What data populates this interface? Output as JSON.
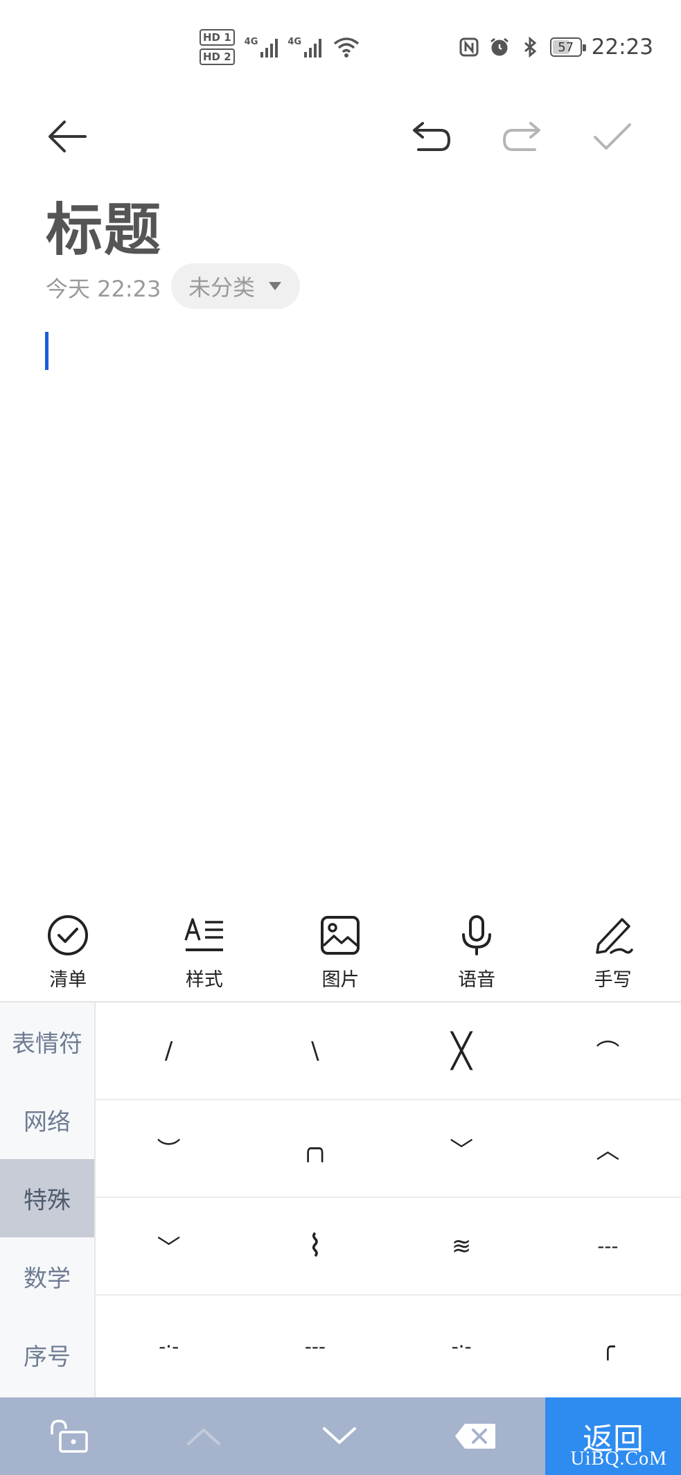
{
  "status_bar": {
    "hd1": "HD 1",
    "hd2": "HD 2",
    "sim1_network": "4G",
    "sim2_network": "4G",
    "battery_level": "57",
    "time": "22:23"
  },
  "note": {
    "title": "标题",
    "date": "今天 22:23",
    "category": "未分类"
  },
  "editor_toolbar": {
    "items": [
      {
        "label": "清单",
        "icon": "checklist-icon"
      },
      {
        "label": "样式",
        "icon": "text-style-icon"
      },
      {
        "label": "图片",
        "icon": "image-icon"
      },
      {
        "label": "语音",
        "icon": "microphone-icon"
      },
      {
        "label": "手写",
        "icon": "pen-icon"
      }
    ]
  },
  "keyboard": {
    "categories": [
      "表情符",
      "网络",
      "特殊",
      "数学",
      "序号"
    ],
    "active_category": "特殊",
    "symbols": [
      [
        "/",
        "\\",
        "╳",
        "⌒"
      ],
      [
        "︶",
        "╭╮",
        "﹀",
        "︿"
      ],
      [
        "﹀",
        "⌇",
        "≋",
        "---"
      ],
      [
        "-·-",
        "---",
        "-·-",
        "╭"
      ]
    ],
    "return_label": "返回"
  },
  "watermark": "UiBQ.CoM",
  "colors": {
    "accent": "#2e8bf0",
    "caret": "#1a5fd8",
    "bottom_bar": "#a6b3cc"
  }
}
